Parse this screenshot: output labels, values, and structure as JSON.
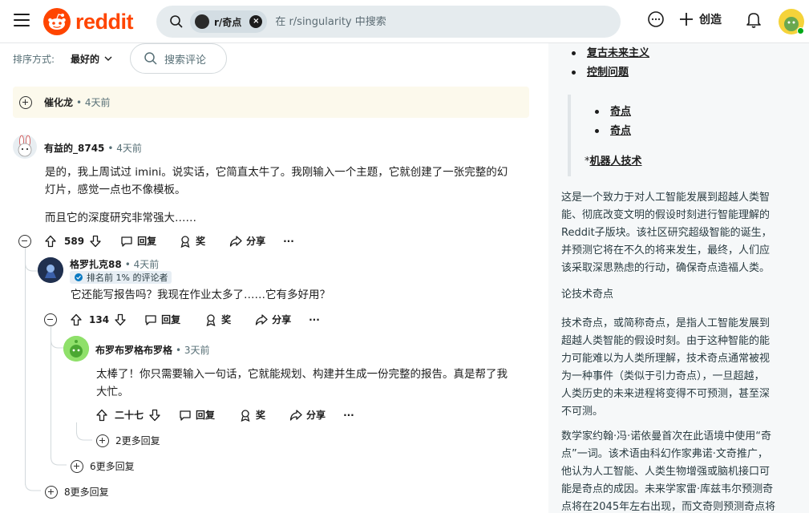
{
  "header": {
    "logo_text": "reddit",
    "search_chip": "r/奇点",
    "search_placeholder": "在 r/singularity 中搜索",
    "create_label": "创造"
  },
  "sort": {
    "label": "排序方式:",
    "value": "最好的",
    "comment_search": "搜索评论"
  },
  "collapsed_comment": {
    "username": "催化龙",
    "time": "• 4天前"
  },
  "comment1": {
    "username": "有益的_8745",
    "time": "• 4天前",
    "body_line1": "是的，我上周试过 imini。说实话，它简直太牛了。我刚输入一个主题，它就创建了一张完整的幻",
    "body_line2": "灯片，感觉一点也不像模板。",
    "body_line3": "而且它的深度研究非常强大……",
    "votes": "589",
    "reply": "回复",
    "award": "奖",
    "share": "分享",
    "more": "···"
  },
  "comment2": {
    "username": "格罗扎克88",
    "time": "• 4天前",
    "badge": "排名前 1% 的评论者",
    "body": "它还能写报告吗？我现在作业太多了……它有多好用？",
    "votes": "134",
    "reply": "回复",
    "award": "奖",
    "share": "分享",
    "more": "···"
  },
  "comment3": {
    "username": "布罗布罗格布罗格",
    "time": "• 3天前",
    "body_line1": "太棒了！你只需要输入一句话，它就能规划、构建并生成一份完整的报告。真是帮了我",
    "body_line2": "大忙。",
    "votes": "二十七",
    "reply": "回复",
    "award": "奖",
    "share": "分享",
    "more": "···"
  },
  "more_replies": {
    "level3": "2更多回复",
    "level2": "6更多回复",
    "level1": "8更多回复"
  },
  "sidebar": {
    "list_top": [
      "复古未来主义",
      "控制问题"
    ],
    "list_nested": [
      "奇点",
      "奇点"
    ],
    "robot_prefix": "*",
    "robot_link": "机器人技术",
    "para1": [
      "这是一个致力于对人工智能发展到超越人类智",
      "能、彻底改变文明的假设时刻进行智能理解的",
      "Reddit子版块。该社区研究超级智能的诞生，",
      "并预测它将在不久的将来发生，最终，人们应",
      "该采取深思熟虑的行动，确保奇点造福人类。"
    ],
    "heading": "论技术奇点",
    "para2": [
      "技术奇点，或简称奇点，是指人工智能发展到",
      "超越人类智能的假设时刻。由于这种智能的能",
      "力可能难以为人类所理解，技术奇点通常被视",
      "为一种事件（类似于引力奇点），一旦超越，",
      "人类历史的未来进程将变得不可预测，甚至深",
      "不可测。"
    ],
    "para3": [
      "数学家约翰·冯·诺依曼首次在此语境中使用“奇",
      "点”一词。该术语由科幻作家弗诺·文奇推广，",
      "他认为人工智能、人类生物增强或脑机接口可",
      "能是奇点的成因。未来学家雷·库兹韦尔预测奇",
      "点将在2045年左右出现，而文奇则预测奇点将"
    ]
  },
  "colors": {
    "brand": "#ff4500",
    "collapsed_bg": "#fcf9ec",
    "sidebar_bg": "#f6f8f9"
  }
}
